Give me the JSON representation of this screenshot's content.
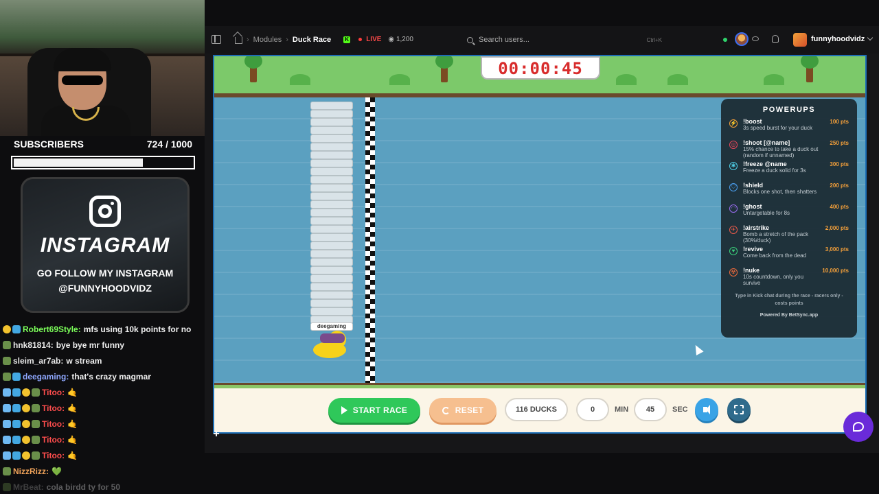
{
  "overlay": {
    "subs_label": "SUBSCRIBERS",
    "subs_count": "724 / 1000",
    "subs_progress": 0.724,
    "insta_title": "INSTAGRAM",
    "insta_line1": "GO FOLLOW MY INSTAGRAM",
    "insta_line2": "@FUNNYHOODVIDZ"
  },
  "chat": [
    {
      "user": "Robert69Style:",
      "message": "mfs using 10k points for no",
      "color": "#7cff5a"
    },
    {
      "user": "hnk81814:",
      "message": "bye bye mr funny",
      "color": "#e8e8e8"
    },
    {
      "user": "sleim_ar7ab:",
      "message": "w stream",
      "color": "#e8e8e8"
    },
    {
      "user": "deegaming:",
      "message": "that's crazy magmar",
      "color": "#8fa8ff"
    },
    {
      "user": "Titoo:",
      "message": "🤙",
      "color": "#ff4d4d"
    },
    {
      "user": "Titoo:",
      "message": "🤙",
      "color": "#ff4d4d"
    },
    {
      "user": "Titoo:",
      "message": "🤙",
      "color": "#ff4d4d"
    },
    {
      "user": "Titoo:",
      "message": "🤙",
      "color": "#ff4d4d"
    },
    {
      "user": "Titoo:",
      "message": "🤙",
      "color": "#ff4d4d"
    },
    {
      "user": "NizzRizz:",
      "message": "💚",
      "color": "#f2a45a"
    },
    {
      "user": "MrBeat:",
      "message": "cola birdd ty for 50",
      "color": "#9a9a9a"
    }
  ],
  "topbar": {
    "crumb_modules": "Modules",
    "crumb_current": "Duck Race",
    "live_label": "LIVE",
    "viewers": "1,200",
    "search_placeholder": "Search users...",
    "search_shortcut": "Ctrl+K",
    "username": "funnyhoodvidz"
  },
  "race": {
    "timer": "00:00:45",
    "leader_name": "deegaming",
    "start_label": "START RACE",
    "reset_label": "RESET",
    "ducks_label": "116 DUCKS",
    "minutes": "0",
    "min_label": "MIN",
    "seconds": "45",
    "sec_label": "SEC"
  },
  "powerups": {
    "title": "POWERUPS",
    "items": [
      {
        "cmd": "!boost",
        "desc": "3s speed burst for your duck",
        "pts": "100 pts",
        "icon": "bolt-icon",
        "color": "#f6a13a"
      },
      {
        "cmd": "!shoot [@name]",
        "desc": "15% chance to take a duck out (random if unnamed)",
        "pts": "250 pts",
        "icon": "target-icon",
        "color": "#e8465a"
      },
      {
        "cmd": "!freeze @name",
        "desc": "Freeze a duck solid for 3s",
        "pts": "300 pts",
        "icon": "snowflake-icon",
        "color": "#4fd0e8"
      },
      {
        "cmd": "!shield",
        "desc": "Blocks one shot, then shatters",
        "pts": "200 pts",
        "icon": "shield-icon",
        "color": "#4a9ff0"
      },
      {
        "cmd": "!ghost",
        "desc": "Untargetable for 8s",
        "pts": "400 pts",
        "icon": "ghost-icon",
        "color": "#9a6cf0"
      },
      {
        "cmd": "!airstrike",
        "desc": "Bomb a stretch of the pack (30%/duck)",
        "pts": "2,000 pts",
        "icon": "plane-icon",
        "color": "#e85a4a"
      },
      {
        "cmd": "!revive",
        "desc": "Come back from the dead",
        "pts": "3,000 pts",
        "icon": "heart-icon",
        "color": "#3ad07a"
      },
      {
        "cmd": "!nuke",
        "desc": "10s countdown, only you survive",
        "pts": "10,000 pts",
        "icon": "nuke-icon",
        "color": "#f06a3a"
      }
    ],
    "footer": "Type in Kick chat during the race - racers only - costs points",
    "powered": "Powered By BetSync.app"
  }
}
